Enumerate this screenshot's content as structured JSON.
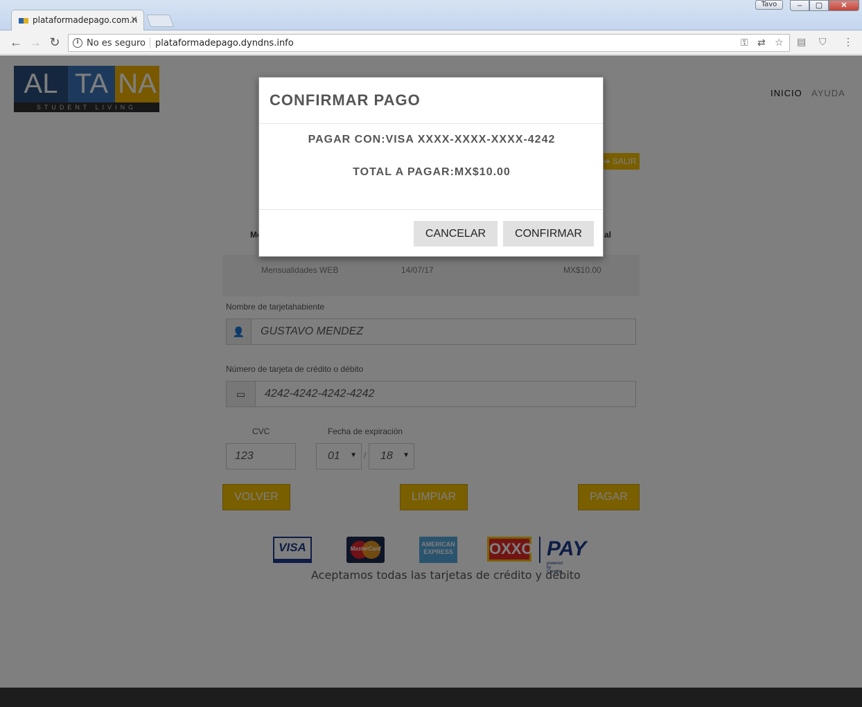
{
  "browser": {
    "tab_title": "plataformadepago.com.n",
    "tab_close": "×",
    "user_badge": "Tavo",
    "win_min": "–",
    "win_max": "▢",
    "win_close": "✕",
    "security_text": "No es seguro",
    "url": "plataformadepago.dyndns.info"
  },
  "site": {
    "logo_al": "AL",
    "logo_ta": "TA",
    "logo_na": "NA",
    "logo_tagline": "STUDENT LIVING",
    "nav_inicio": "INICIO",
    "nav_ayuda": "AYUDA",
    "salir_label": "SALIR"
  },
  "table": {
    "col1_partial": "Me",
    "col3_partial": "al",
    "row": {
      "concepto": "Mensualidades WEB",
      "fecha": "14/07/17",
      "total": "MX$10.00"
    }
  },
  "form": {
    "holder_label": "Nombre de tarjetahabiente",
    "holder_value": "GUSTAVO MENDEZ",
    "card_label": "Número de tarjeta de crédito o débito",
    "card_value": "4242-4242-4242-4242",
    "cvc_label": "CVC",
    "cvc_value": "123",
    "exp_label": "Fecha de expiración",
    "exp_month": "01",
    "exp_year": "18",
    "exp_sep": "/"
  },
  "buttons": {
    "volver": "VOLVER",
    "limpiar": "LIMPIAR",
    "pagar": "PAGAR"
  },
  "payment_methods": {
    "visa": "VISA",
    "mastercard": "MasterCard",
    "amex": "AMERICAN EXPRESS",
    "oxxo": "OXXO",
    "pay": "PAY",
    "pay_sub": "powered by Conekta",
    "accept_text": "Aceptamos todas las tarjetas de crédito y débito"
  },
  "modal": {
    "title": "CONFIRMAR PAGO",
    "pay_with": "PAGAR CON:VISA XXXX-XXXX-XXXX-4242",
    "total": "TOTAL A PAGAR:MX$10.00",
    "cancel_label": "CANCELAR",
    "confirm_label": "CONFIRMAR"
  },
  "colors": {
    "gold": "#f2be00",
    "logo_dark_blue": "#2b4f7d",
    "logo_blue": "#3a74b8",
    "logo_yellow": "#f3b300"
  }
}
